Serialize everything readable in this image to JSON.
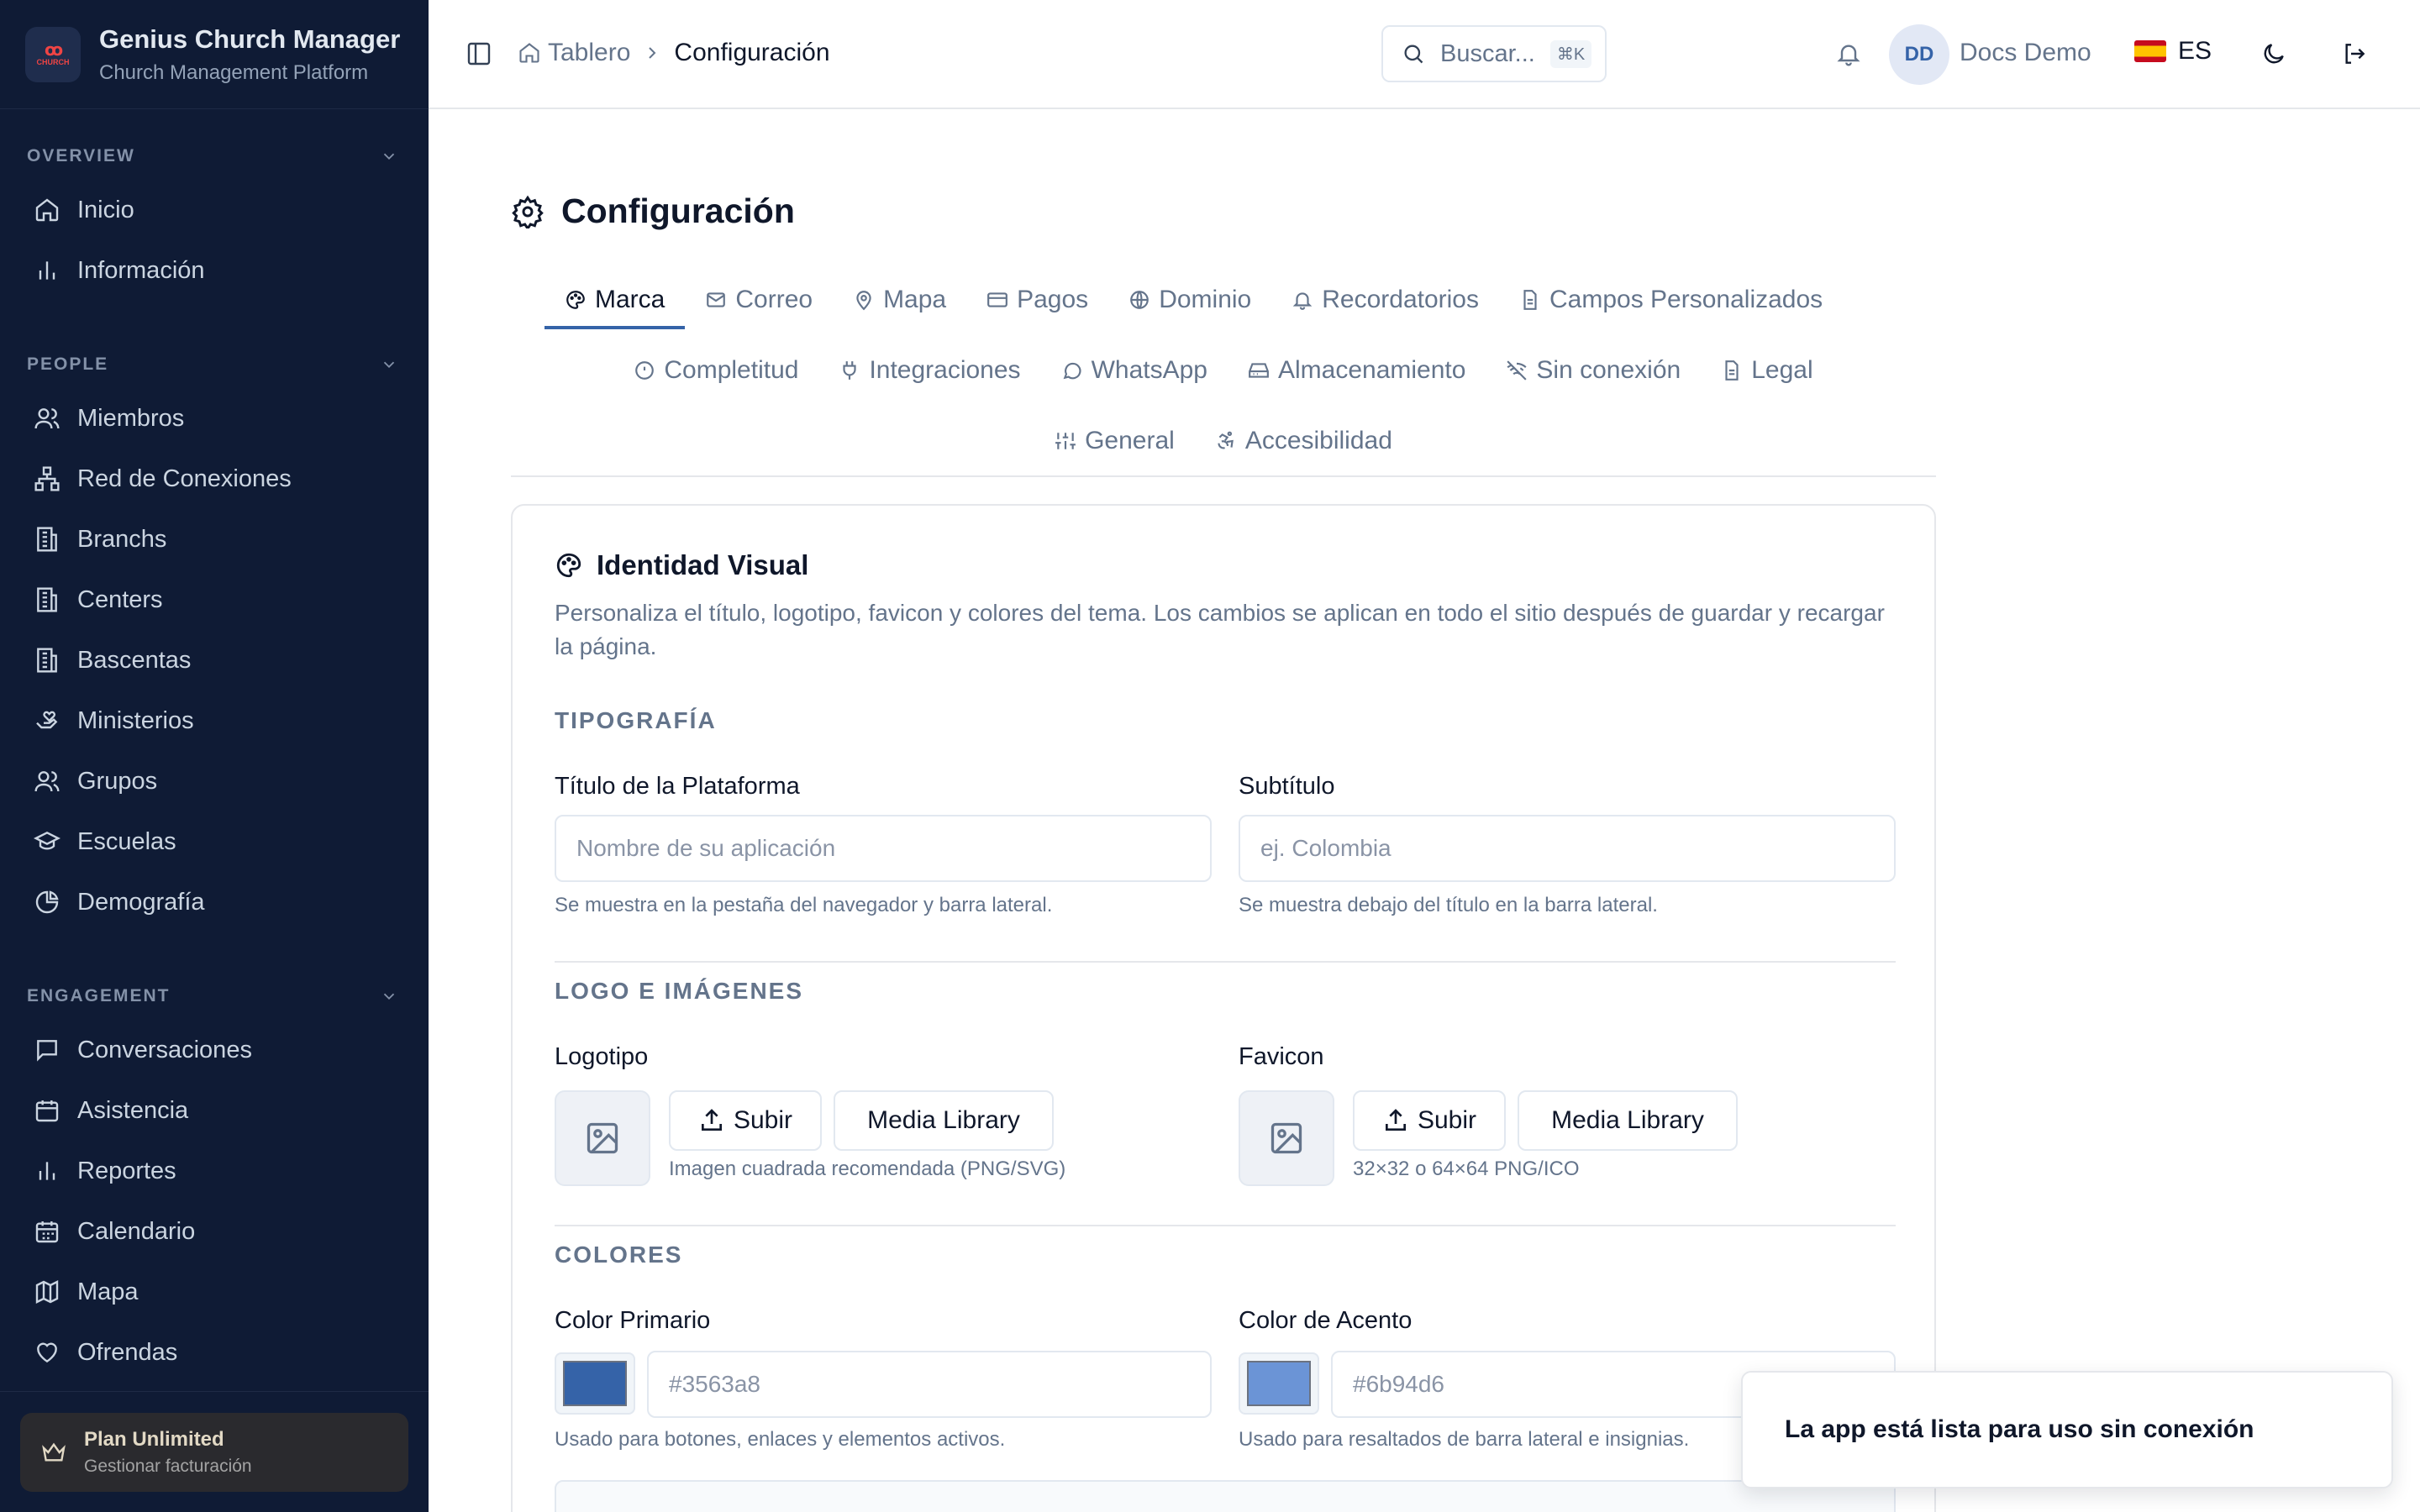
{
  "app": {
    "title": "Genius Church Manager",
    "subtitle": "Church Management Platform",
    "logo_text": "CHURCH MANAGER"
  },
  "sidebar": {
    "sections": [
      {
        "title": "OVERVIEW",
        "items": [
          {
            "label": "Inicio",
            "icon": "home-icon"
          },
          {
            "label": "Información",
            "icon": "bar-chart-icon"
          }
        ]
      },
      {
        "title": "PEOPLE",
        "items": [
          {
            "label": "Miembros",
            "icon": "users-icon"
          },
          {
            "label": "Red de Conexiones",
            "icon": "network-icon"
          },
          {
            "label": "Branchs",
            "icon": "building-icon"
          },
          {
            "label": "Centers",
            "icon": "building-icon"
          },
          {
            "label": "Bascentas",
            "icon": "building-icon"
          },
          {
            "label": "Ministerios",
            "icon": "hand-heart-icon"
          },
          {
            "label": "Grupos",
            "icon": "users-icon"
          },
          {
            "label": "Escuelas",
            "icon": "graduation-cap-icon"
          },
          {
            "label": "Demografía",
            "icon": "pie-chart-icon"
          }
        ]
      },
      {
        "title": "ENGAGEMENT",
        "items": [
          {
            "label": "Conversaciones",
            "icon": "message-icon"
          },
          {
            "label": "Asistencia",
            "icon": "calendar-check-icon"
          },
          {
            "label": "Reportes",
            "icon": "bar-chart-icon"
          },
          {
            "label": "Calendario",
            "icon": "calendar-icon"
          },
          {
            "label": "Mapa",
            "icon": "map-icon"
          },
          {
            "label": "Ofrendas",
            "icon": "heart-icon"
          }
        ]
      }
    ],
    "plan": {
      "title": "Plan Unlimited",
      "subtitle": "Gestionar facturación"
    }
  },
  "topbar": {
    "breadcrumb": {
      "home": "Tablero",
      "current": "Configuración"
    },
    "search": {
      "placeholder": "Buscar...",
      "shortcut": "⌘K"
    },
    "user": {
      "initials": "DD",
      "name": "Docs Demo"
    },
    "language": "ES"
  },
  "page": {
    "title": "Configuración",
    "tabs_row1": [
      "Marca",
      "Correo",
      "Mapa",
      "Pagos",
      "Dominio",
      "Recordatorios",
      "Campos Personalizados"
    ],
    "tabs_row2": [
      "Completitud",
      "Integraciones",
      "WhatsApp",
      "Almacenamiento",
      "Sin conexión",
      "Legal"
    ],
    "tabs_row3": [
      "General",
      "Accesibilidad"
    ],
    "active_tab": "Marca"
  },
  "card": {
    "title": "Identidad Visual",
    "description": "Personaliza el título, logotipo, favicon y colores del tema. Los cambios se aplican en todo el sitio después de guardar y recargar la página.",
    "typography": {
      "section": "TIPOGRAFÍA",
      "title_label": "Título de la Plataforma",
      "title_placeholder": "Nombre de su aplicación",
      "title_hint": "Se muestra en la pestaña del navegador y barra lateral.",
      "subtitle_label": "Subtítulo",
      "subtitle_placeholder": "ej. Colombia",
      "subtitle_hint": "Se muestra debajo del título en la barra lateral."
    },
    "images": {
      "section": "LOGO E IMÁGENES",
      "logo_label": "Logotipo",
      "logo_hint": "Imagen cuadrada recomendada (PNG/SVG)",
      "favicon_label": "Favicon",
      "favicon_hint": "32×32 o 64×64 PNG/ICO",
      "upload": "Subir",
      "media_library": "Media Library"
    },
    "colors": {
      "section": "COLORES",
      "primary_label": "Color Primario",
      "primary_value": "#3563a8",
      "primary_hint": "Usado para botones, enlaces y elementos activos.",
      "accent_label": "Color de Acento",
      "accent_value": "#6b94d6",
      "accent_hint": "Usado para resaltados de barra lateral e insignias."
    }
  },
  "toast": {
    "message": "La app está lista para uso sin conexión"
  },
  "colors": {
    "sidebar_bg": "#0f1b35",
    "primary": "#3563a8",
    "accent": "#6b94d6"
  }
}
